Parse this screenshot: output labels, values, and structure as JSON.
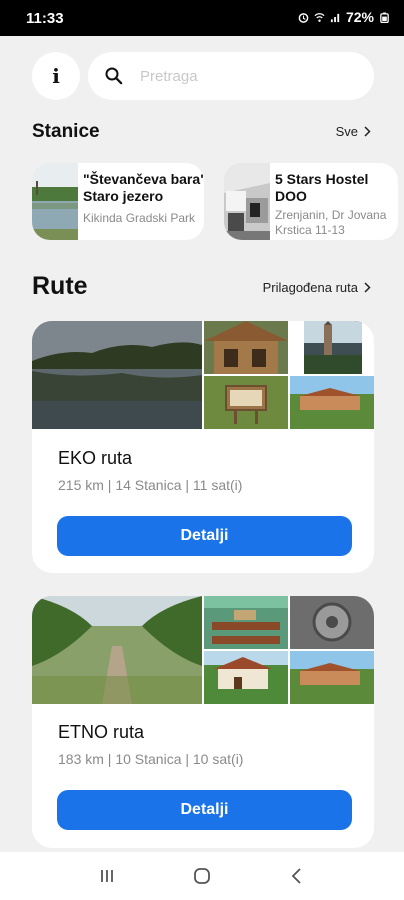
{
  "status_bar": {
    "time": "11:33",
    "battery": "72%"
  },
  "search": {
    "placeholder": "Pretraga",
    "info_label": "i"
  },
  "stations": {
    "title": "Stanice",
    "see_all": "Sve",
    "items": [
      {
        "name_line1": "\"Števančeva bara\"",
        "name_line2": "Staro jezero",
        "address_line1": "Kikinda Gradski Park",
        "address_line2": ""
      },
      {
        "name_line1": "5 Stars Hostel",
        "name_line2": "DOO",
        "address_line1": "Zrenjanin, Dr Jovana",
        "address_line2": "Krstica 11-13"
      }
    ]
  },
  "routes": {
    "title": "Rute",
    "custom_link": "Prilagođena ruta",
    "items": [
      {
        "name": "EKO ruta",
        "meta": "215 km | 14 Stanica | 11 sat(i)",
        "button": "Detalji"
      },
      {
        "name": "ETNO ruta",
        "meta": "183 km | 10 Stanica | 10 sat(i)",
        "button": "Detalji"
      }
    ]
  },
  "colors": {
    "accent": "#1a73e8",
    "background": "#f0f0f0",
    "card": "#ffffff"
  },
  "icons": [
    "alarm-icon",
    "wifi-icon",
    "signal-icon",
    "battery-icon",
    "search-icon",
    "chevron-right-icon",
    "recents-icon",
    "home-icon",
    "back-icon"
  ]
}
